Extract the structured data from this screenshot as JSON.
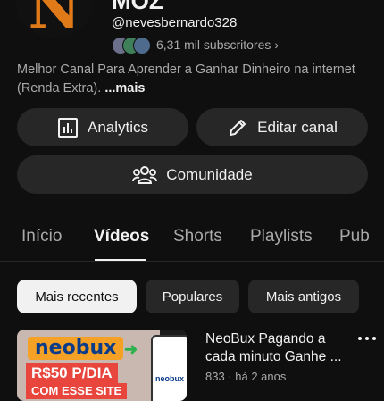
{
  "channel": {
    "avatar_letter": "N",
    "name": "MOZ",
    "handle": "@nevesbernardo328",
    "subscribers": "6,31 mil subscritores",
    "description": "Melhor Canal Para Aprender a Ganhar Dinheiro na internet (Renda Extra).",
    "more_label": "...mais"
  },
  "actions": {
    "analytics": "Analytics",
    "edit_channel": "Editar canal",
    "community": "Comunidade"
  },
  "tabs": [
    "Início",
    "Vídeos",
    "Shorts",
    "Playlists",
    "Pub"
  ],
  "active_tab": "Vídeos",
  "filters": [
    "Mais recentes",
    "Populares",
    "Mais antigos"
  ],
  "selected_filter": "Mais recentes",
  "video": {
    "title": "NeoBux Pagando a cada minuto Ganhe ...",
    "meta": "833 · há 2 anos",
    "thumb": {
      "brand": "neobux",
      "line1": "R$50 P/DIA",
      "line2": "COM ESSE SITE",
      "phone_label": "neobux"
    }
  },
  "colors": {
    "background": "#0f0f0f",
    "button_bg": "#272727",
    "text_primary": "#f1f1f1",
    "text_secondary": "#aaaaaa",
    "avatar_letter": "#e07a18"
  },
  "icons": {
    "analytics": "bar-chart-icon",
    "edit": "pencil-icon",
    "community": "people-icon",
    "more": "more-vertical-icon",
    "chevron": "chevron-right-icon"
  }
}
